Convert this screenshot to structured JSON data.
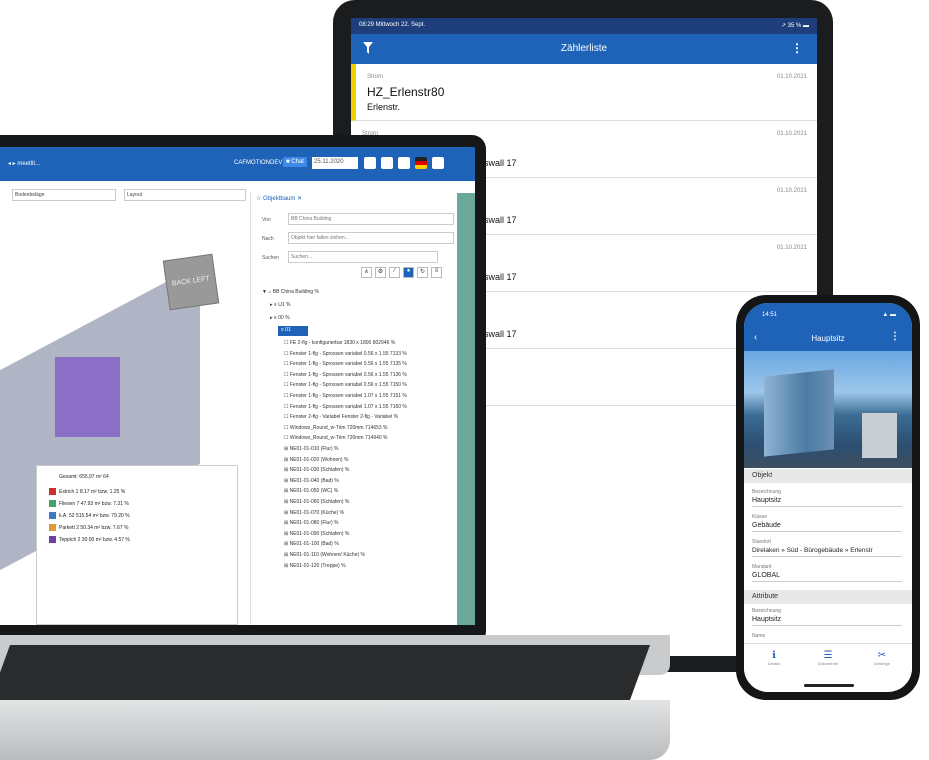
{
  "tablet": {
    "status_time": "08:29  Mittwoch 22. Sept.",
    "status_right": "↗ 35 % ▬",
    "title": "Zählerliste",
    "menu_icon": "more-vert-icon",
    "rows": [
      {
        "label": "Strom",
        "date": "01.10.2021",
        "title": "HZ_Erlenstr80",
        "subtitle": "Erlenstr."
      },
      {
        "label": "Strom",
        "date": "01.10.2021",
        "title": "",
        "subtitle": "swall 17"
      },
      {
        "label": "",
        "date": "01.10.2021",
        "title": "",
        "subtitle": "swall 17"
      },
      {
        "label": "",
        "date": "01.10.2021",
        "title": "",
        "subtitle": "swall 17"
      },
      {
        "label": "",
        "date": "",
        "title": "",
        "subtitle": "swall 17"
      }
    ]
  },
  "laptop": {
    "menu": "◂ ▸  meetlit...",
    "user": "CAFMOTIONDEV",
    "plan_label": "■ Chat",
    "date": "25.11.2020",
    "selects": [
      "Bodenbeläge",
      "Layout"
    ],
    "cube_label": "BACK  LEFT",
    "legend": {
      "total": "Gesamt: 655,97 m² 64",
      "items": [
        {
          "color": "#c9302c",
          "text": "Estrich 1 8.17 m² bzw. 1.25 %"
        },
        {
          "color": "#3fa66b",
          "text": "Fliesen 7 47.93 m² bzw. 7.31 %"
        },
        {
          "color": "#3b7ac7",
          "text": "k.A. 52 515.54 m² bzw. 79.20 %"
        },
        {
          "color": "#e49a2a",
          "text": "Parkett 2 50.34 m² bzw. 7.67 %"
        },
        {
          "color": "#6b3fa6",
          "text": "Teppich 2 30.00 m² bzw. 4.57 %"
        }
      ]
    },
    "tree": {
      "tab": "☆ Objektbaum ✕",
      "von_label": "Von",
      "von_value": "BB China Building",
      "nach_label": "Nach",
      "nach_placeholder": "Objekt hier fallen ziehen...",
      "suchen_label": "Suchen",
      "suchen_placeholder": "Suchen...",
      "root": "▼ ⌂ BB China Building  %",
      "nodes": [
        "▸ ≡ U1  %",
        "▸ ≡ 00  %"
      ],
      "selected": "≡ 01",
      "items": [
        "☐ FE 2-flg - konfigurierbar 1830 x 1800 802946  %",
        "☐ Fenster 1-flg - Sprossen variabel 0.56 x 1.55 7133  %",
        "☐ Fenster 1-flg - Sprossen variabel 0.56 x 1.55 7135  %",
        "☐ Fenster 1-flg - Sprossen variabel 0.56 x 1.55 7136  %",
        "☐ Fenster 1-flg - Sprossen variabel 0.56 x 1.55 7150  %",
        "☐ Fenster 1-flg - Sprossen variabel 1.07 x 1.55 7151  %",
        "☐ Fenster 1-flg - Sprossen variabel 1.07 x 1.55 7160  %",
        "☐ Fenster 2-flg - Variabel Fenster 2-flg - Variabel  %",
        "☐ Windows_Round_w-Trim 720mm 714653  %",
        "☐ Windows_Round_w-Trim 720mm 714940  %",
        "⊞ NE01-01-010 (Flur)  %",
        "⊞ NE01-01-020 (Wohnen)  %",
        "⊞ NE01-01-030 (Schlafen)  %",
        "⊞ NE01-01-040 (Bad)  %",
        "⊞ NE01-01-050 (WC)  %",
        "⊞ NE01-01-060 (Schlafen)  %",
        "⊞ NE01-01-070 (Küche)  %",
        "⊞ NE01-01-080 (Flur)  %",
        "⊞ NE01-01-090 (Schlafen)  %",
        "⊞ NE01-01-100 (Bad)  %",
        "⊞ NE01-01-110 (Wohnen/ Küche)  %",
        "⊞ NE01-01-120 (Treppe)  %"
      ],
      "tools": [
        "∧",
        "⚙",
        "∕",
        "●",
        "↻",
        "≡"
      ]
    }
  },
  "phone": {
    "time": "14:51",
    "status_right": "▲ ▬",
    "title": "Hauptsitz",
    "section_objekt": "Objekt",
    "fields": [
      {
        "label": "Bezeichnung",
        "value": "Hauptsitz"
      },
      {
        "label": "Klasse",
        "value": "Gebäude"
      },
      {
        "label": "Standort",
        "value": "Direlaken » Süd - Bürogebäude » Erlenstr"
      },
      {
        "label": "Mandant",
        "value": "GLOBAL"
      }
    ],
    "section_attribute": "Attribute",
    "attr_fields": [
      {
        "label": "Bezeichnung",
        "value": "Hauptsitz"
      },
      {
        "label": "Name",
        "value": ""
      }
    ],
    "tabs": [
      {
        "icon": "info-icon",
        "glyph": "ℹ",
        "label": "Details"
      },
      {
        "icon": "list-icon",
        "glyph": "☰",
        "label": "Dokumente"
      },
      {
        "icon": "paperclip-icon",
        "glyph": "✂",
        "label": "Anhänge"
      }
    ]
  }
}
